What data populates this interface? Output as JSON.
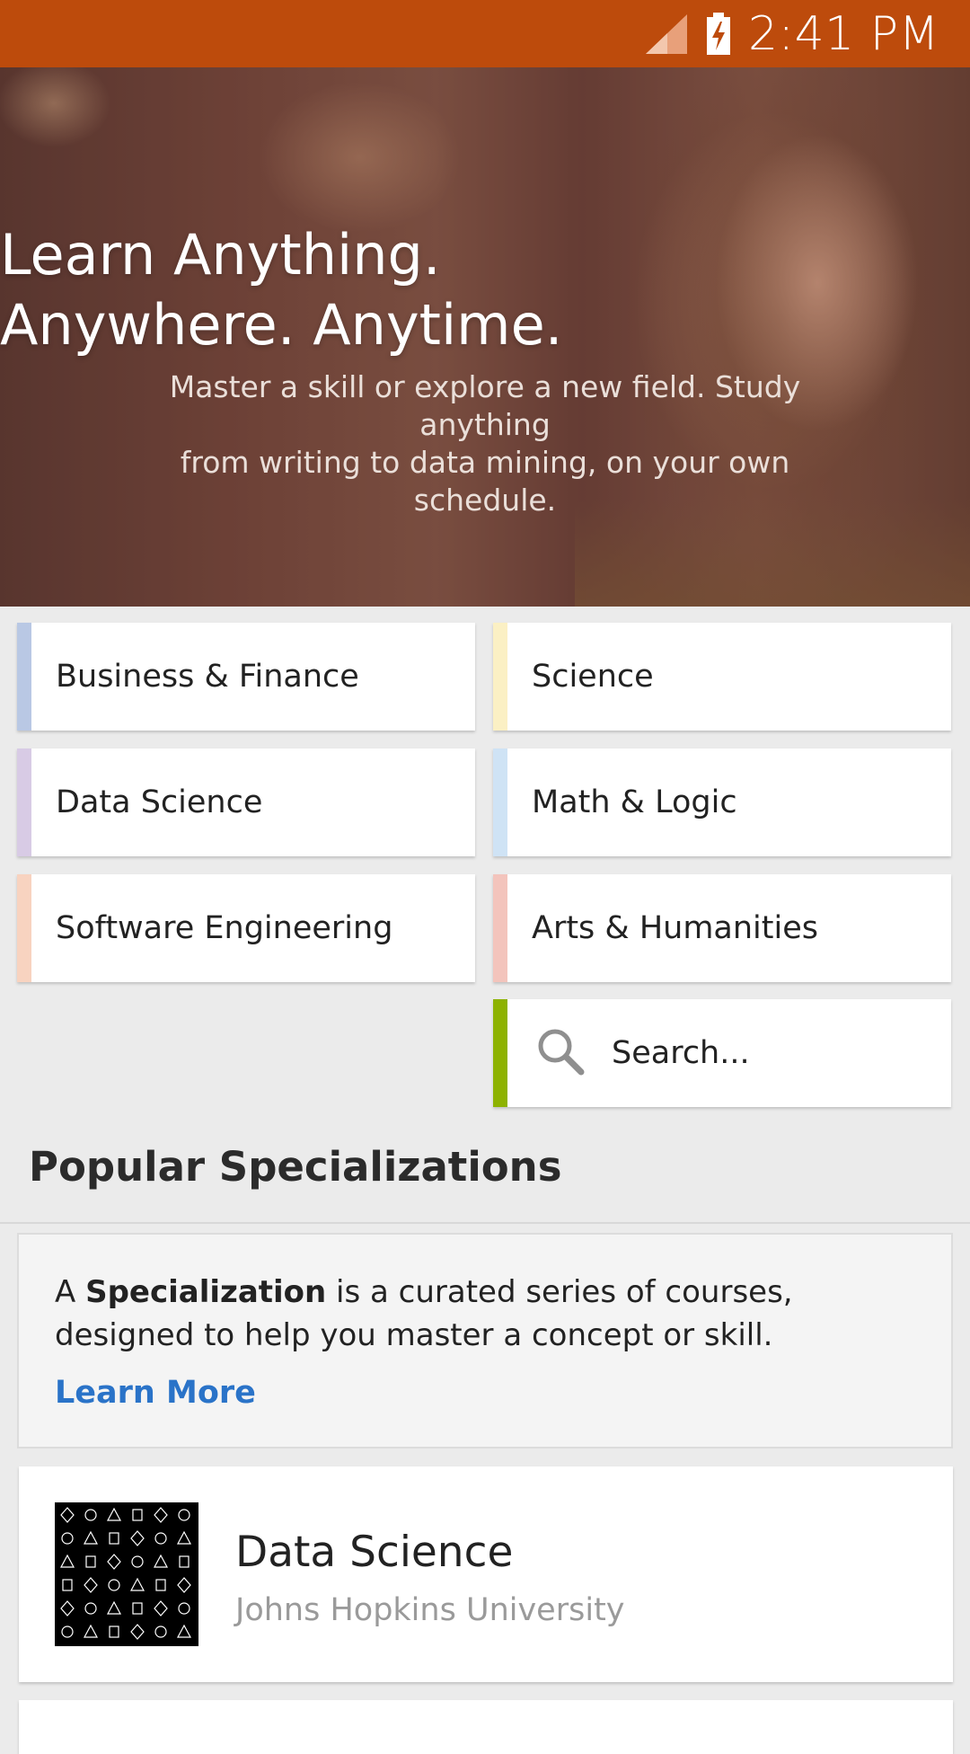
{
  "status_bar": {
    "time": "2:41 PM",
    "icons": [
      "signal-icon",
      "battery-charging-icon"
    ],
    "background": "#bd4b0c"
  },
  "hero": {
    "title_line1": "Learn Anything.",
    "title_line2": "Anywhere. Anytime.",
    "subtitle_line1": "Master a skill or explore a new field. Study anything",
    "subtitle_line2": "from writing to data mining, on your own schedule."
  },
  "categories": [
    {
      "label": "Business & Finance",
      "accent": "#b9c8e4"
    },
    {
      "label": "Science",
      "accent": "#fbf0c4"
    },
    {
      "label": "Data Science",
      "accent": "#d8cbe5"
    },
    {
      "label": "Math & Logic",
      "accent": "#cfe3f5"
    },
    {
      "label": "Software Engineering",
      "accent": "#f8d3c0"
    },
    {
      "label": "Arts & Humanities",
      "accent": "#f3c4bc"
    }
  ],
  "search": {
    "placeholder": "Search...",
    "accent": "#8db200",
    "icon": "search-icon"
  },
  "popular": {
    "title": "Popular Specializations",
    "info_prefix": "A ",
    "info_bold": "Specialization",
    "info_suffix": " is a curated series of courses, designed to help you master a concept or skill.",
    "learn_more": "Learn More",
    "link_color": "#2a73c8"
  },
  "specializations": [
    {
      "title": "Data Science",
      "provider": "Johns Hopkins University"
    }
  ]
}
